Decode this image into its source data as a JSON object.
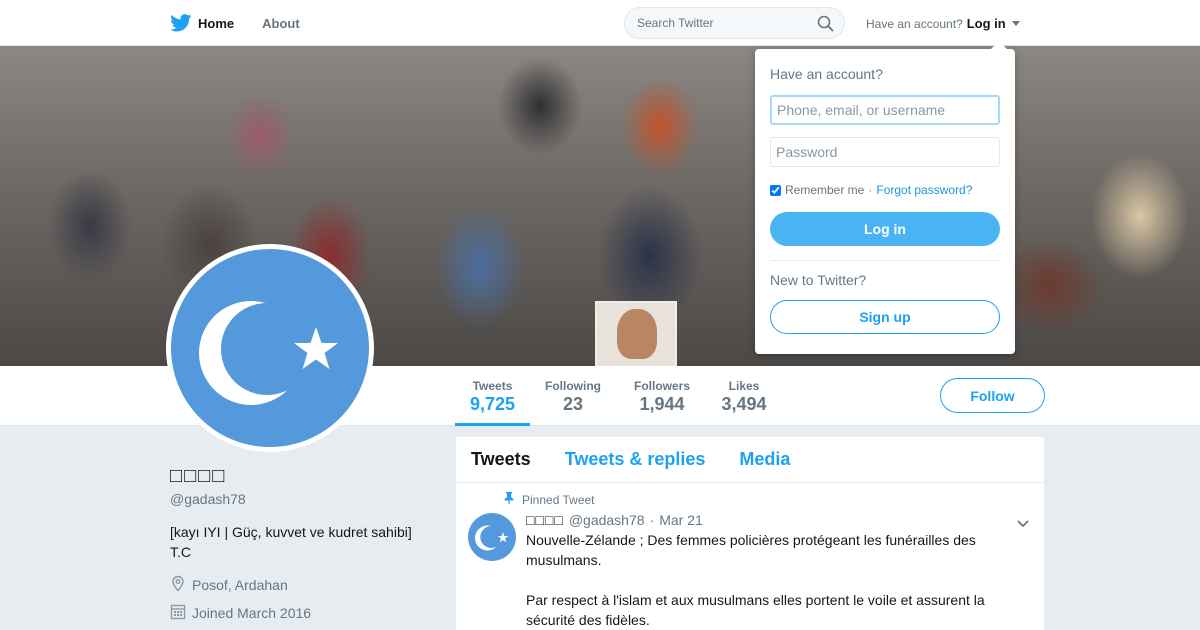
{
  "colors": {
    "accent": "#1da1f2",
    "avatar_bg": "#5399dc",
    "page_bg": "#e6ecf0"
  },
  "nav": {
    "home_label": "Home",
    "home_icon": "twitter-bird-icon",
    "about_label": "About",
    "search_placeholder": "Search Twitter",
    "search_icon": "search-icon",
    "have_account": "Have an account?",
    "login_label": "Log in"
  },
  "profile_nav": {
    "stats": [
      {
        "label": "Tweets",
        "value": "9,725"
      },
      {
        "label": "Following",
        "value": "23"
      },
      {
        "label": "Followers",
        "value": "1,944"
      },
      {
        "label": "Likes",
        "value": "3,494"
      }
    ],
    "follow_label": "Follow"
  },
  "profile": {
    "name": "□□□□",
    "handle": "@gadash78",
    "bio": "[kayı IYI | Güç, kuvvet ve kudret sahibi] T.C",
    "location": "Posof, Ardahan",
    "joined": "Joined March 2016",
    "avatar_emblem": "crescent-and-star"
  },
  "timeline": {
    "tabs": [
      "Tweets",
      "Tweets & replies",
      "Media"
    ],
    "pinned_label": "Pinned Tweet",
    "tweet": {
      "name": "□□□□",
      "handle": "@gadash78",
      "separator": "·",
      "date": "Mar 21",
      "paragraphs": [
        "Nouvelle-Zélande ; Des femmes policières protégeant les funérailles des musulmans.",
        "Par respect à l'islam et aux musulmans elles portent le voile et assurent la sécurité des fidèles."
      ]
    }
  },
  "login_dropdown": {
    "title": "Have an account?",
    "username_placeholder": "Phone, email, or username",
    "password_placeholder": "Password",
    "remember_label": "Remember me",
    "separator": "·",
    "forgot_label": "Forgot password?",
    "remember_checked": true,
    "login_button": "Log in",
    "new_to_twitter": "New to Twitter?",
    "signup_button": "Sign up"
  }
}
